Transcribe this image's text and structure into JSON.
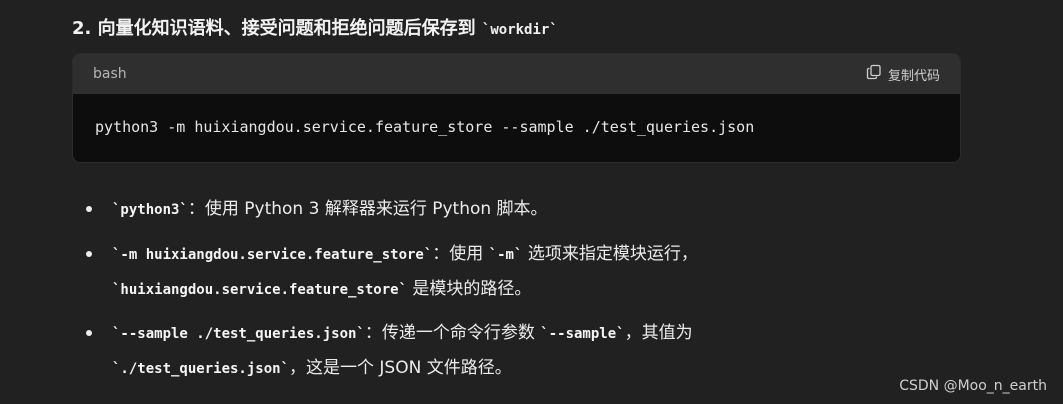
{
  "heading": {
    "text": "2. 向量化知识语料、接受问题和拒绝问题后保存到 ",
    "code": "`workdir`"
  },
  "code_block": {
    "language": "bash",
    "copy_label": "复制代码",
    "code": "python3 -m huixiangdou.service.feature_store --sample ./test_queries.json"
  },
  "bullets": [
    {
      "line1_code": "`python3`",
      "line1_text": "：使用 Python 3 解释器来运行 Python 脚本。"
    },
    {
      "line1_code": "`-m huixiangdou.service.feature_store`",
      "line1_text": "：使用 ",
      "line1_code2": "`-m`",
      "line1_text2": " 选项来指定模块运行，",
      "line2_code": "`huixiangdou.service.feature_store`",
      "line2_text": " 是模块的路径。"
    },
    {
      "line1_code": "`--sample ./test_queries.json`",
      "line1_text": "：传递一个命令行参数 ",
      "line1_code2": "`--sample`",
      "line1_text2": "，其值为",
      "line2_code": "`./test_queries.json`",
      "line2_text": "，这是一个 JSON 文件路径。"
    }
  ],
  "watermark": "CSDN @Moo_n_earth"
}
